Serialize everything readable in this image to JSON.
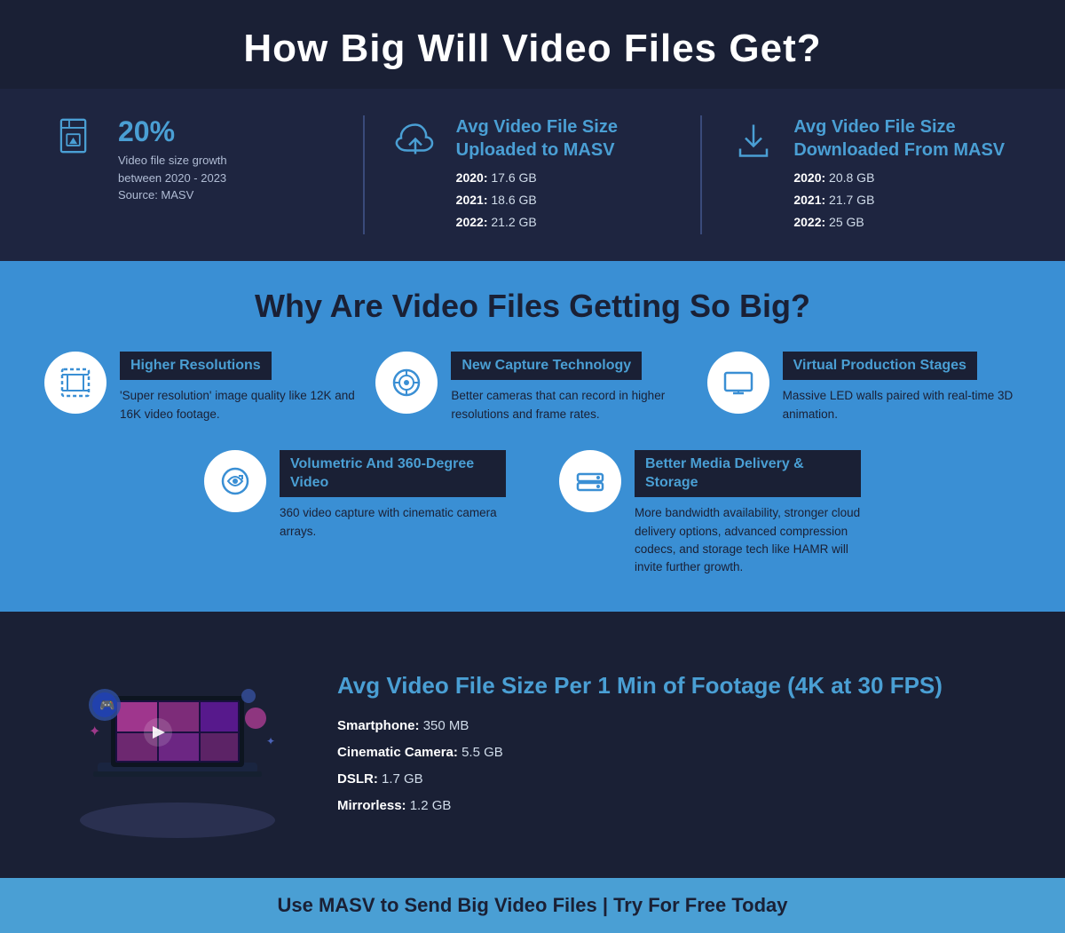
{
  "header": {
    "title": "How Big Will Video Files Get?"
  },
  "stats": {
    "growth": {
      "percentage": "20%",
      "description": "Video file size growth\nbetween 2020 - 2023\nSource: MASV"
    },
    "uploaded": {
      "title": "Avg Video File Size\nUploaded to MASV",
      "year2020_label": "2020:",
      "year2020_value": "17.6 GB",
      "year2021_label": "2021:",
      "year2021_value": "18.6 GB",
      "year2022_label": "2022:",
      "year2022_value": "21.2 GB"
    },
    "downloaded": {
      "title": "Avg Video File Size\nDownloaded From MASV",
      "year2020_label": "2020:",
      "year2020_value": "20.8 GB",
      "year2021_label": "2021:",
      "year2021_value": "21.7 GB",
      "year2022_label": "2022:",
      "year2022_value": "25 GB"
    }
  },
  "why": {
    "heading": "Why Are Video Files Getting So Big?",
    "items": [
      {
        "label": "Higher Resolutions",
        "description": "'Super resolution' image quality like 12K and 16K video footage."
      },
      {
        "label": "New Capture Technology",
        "description": "Better cameras that can record in higher resolutions and frame rates."
      },
      {
        "label": "Virtual Production Stages",
        "description": "Massive LED walls paired with real-time 3D animation."
      },
      {
        "label": "Volumetric And 360-Degree Video",
        "description": "360 video capture with cinematic camera arrays."
      },
      {
        "label": "Better Media Delivery & Storage",
        "description": "More bandwidth availability, stronger cloud delivery options, advanced compression codecs, and storage tech like HAMR will invite further growth."
      }
    ]
  },
  "avg_per_min": {
    "title": "Avg Video File Size Per 1 Min of Footage (4K at 30 FPS)",
    "items": [
      {
        "device": "Smartphone:",
        "size": "350 MB"
      },
      {
        "device": "Cinematic Camera:",
        "size": "5.5 GB"
      },
      {
        "device": "DSLR:",
        "size": "1.7 GB"
      },
      {
        "device": "Mirrorless:",
        "size": "1.2 GB"
      }
    ]
  },
  "footer": {
    "text": "Use MASV to Send Big Video Files | Try For Free Today"
  }
}
